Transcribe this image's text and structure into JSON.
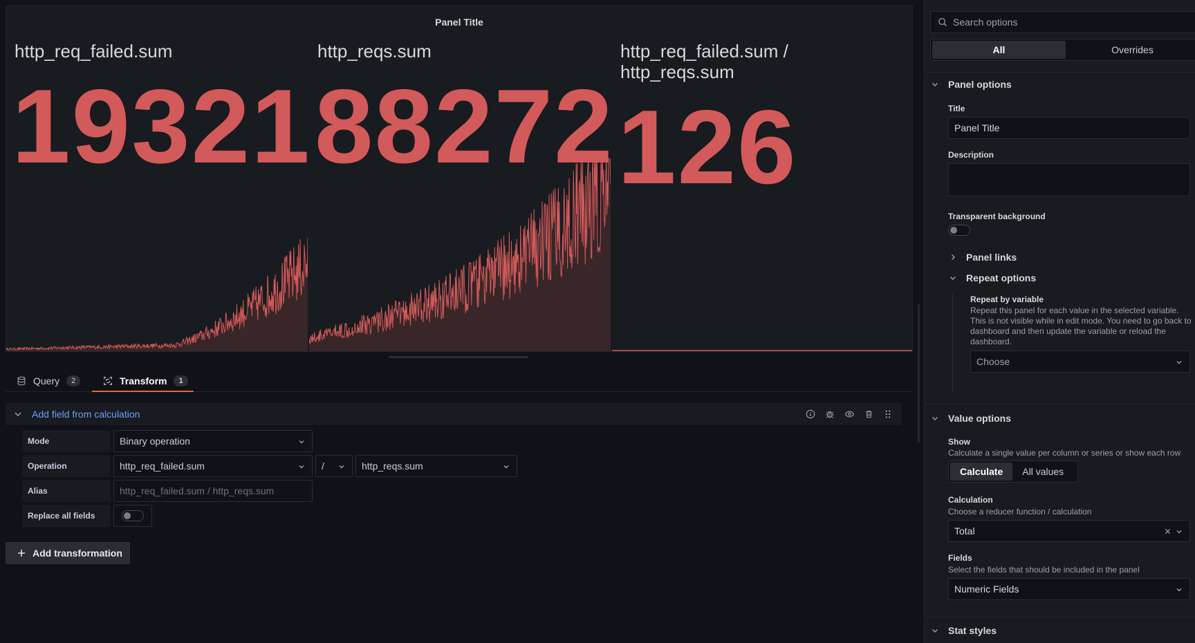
{
  "panel": {
    "title": "Panel Title",
    "stats": [
      {
        "name": "http_req_failed.sum",
        "value": "19321"
      },
      {
        "name": "http_reqs.sum",
        "value": "88272"
      },
      {
        "name": "http_req_failed.sum / http_reqs.sum",
        "value": "126"
      }
    ],
    "color": "#d25a5a"
  },
  "tabs": [
    {
      "label": "Query",
      "count": "2",
      "icon": "database-icon"
    },
    {
      "label": "Transform",
      "count": "1",
      "icon": "transform-icon"
    }
  ],
  "transform": {
    "title": "Add field from calculation",
    "mode_label": "Mode",
    "mode_value": "Binary operation",
    "operation_label": "Operation",
    "operation_left": "http_req_failed.sum",
    "operation_operator": "/",
    "operation_right": "http_reqs.sum",
    "alias_label": "Alias",
    "alias_placeholder": "http_req_failed.sum / http_reqs.sum",
    "replace_label": "Replace all fields",
    "add_button": "Add transformation"
  },
  "options": {
    "search_placeholder": "Search options",
    "tab_all": "All",
    "tab_overrides": "Overrides",
    "panel_options": "Panel options",
    "title_label": "Title",
    "title_value": "Panel Title",
    "description_label": "Description",
    "transparent_label": "Transparent background",
    "panel_links": "Panel links",
    "repeat_options": "Repeat options",
    "repeat_by_label": "Repeat by variable",
    "repeat_by_desc": "Repeat this panel for each value in the selected variable. This is not visible while in edit mode. You need to go back to dashboard and then update the variable or reload the dashboard.",
    "repeat_choose": "Choose",
    "value_options": "Value options",
    "show_label": "Show",
    "show_desc": "Calculate a single value per column or series or show each row",
    "show_calculate": "Calculate",
    "show_all_values": "All values",
    "calc_label": "Calculation",
    "calc_desc": "Choose a reducer function / calculation",
    "calc_value": "Total",
    "fields_label": "Fields",
    "fields_desc": "Select the fields that should be included in the panel",
    "fields_value": "Numeric Fields",
    "stat_styles": "Stat styles"
  }
}
